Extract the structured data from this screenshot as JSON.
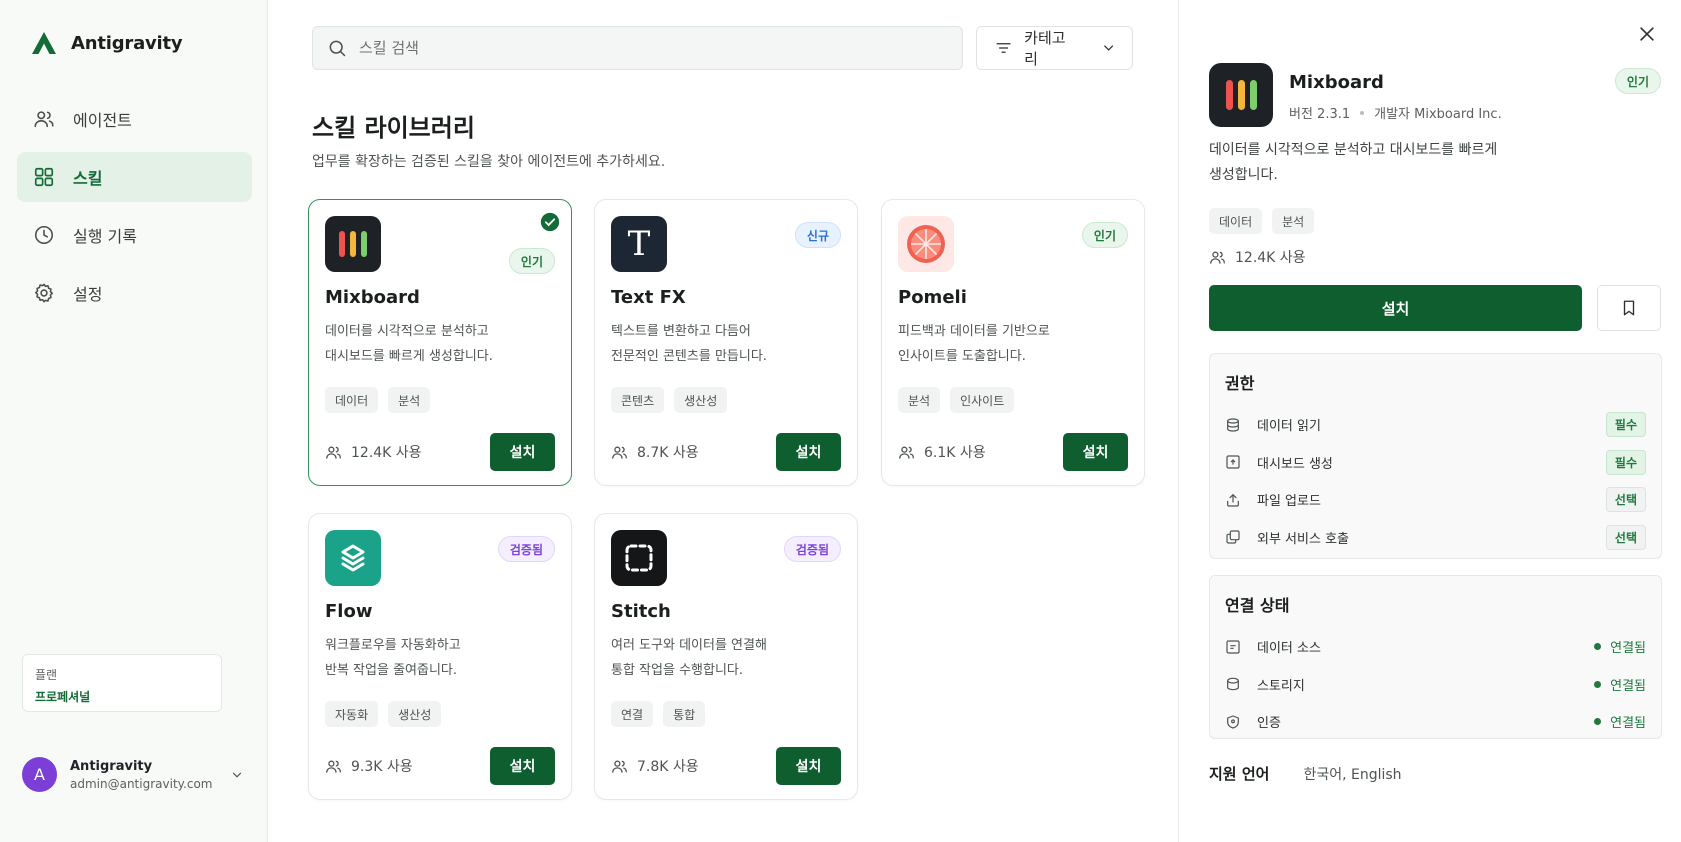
{
  "app": {
    "name": "Antigravity",
    "accent": "#0f5e30"
  },
  "sidebar": {
    "items": [
      {
        "label": "에이전트",
        "icon": "users-icon"
      },
      {
        "label": "스킬",
        "icon": "grid-icon",
        "active": true
      },
      {
        "label": "실행 기록",
        "icon": "clock-icon"
      },
      {
        "label": "설정",
        "icon": "gear-icon"
      }
    ],
    "plan": {
      "label": "플랜",
      "value": "프로페셔널"
    },
    "user": {
      "initial": "A",
      "name": "Antigravity",
      "email": "admin@antigravity.com"
    }
  },
  "main": {
    "search": {
      "placeholder": "스킬 검색"
    },
    "category_label": "카테고리",
    "title": "스킬 라이브러리",
    "subtitle": "업무를 확장하는 검증된 스킬을 찾아 에이전트에 추가하세요.",
    "install_label": "설치",
    "cards": [
      {
        "name": "Mixboard",
        "badge": "인기",
        "badge_type": "pop",
        "desc": [
          "데이터를 시각적으로 분석하고",
          "대시보드를 빠르게 생성합니다."
        ],
        "tags": [
          "데이터",
          "분석"
        ],
        "usage": "12.4K 사용",
        "selected": true
      },
      {
        "name": "Text FX",
        "badge": "신규",
        "badge_type": "new",
        "desc": [
          "텍스트를 변환하고 다듬어",
          "전문적인 콘텐츠를 만듭니다."
        ],
        "tags": [
          "콘텐츠",
          "생산성"
        ],
        "usage": "8.7K 사용"
      },
      {
        "name": "Pomeli",
        "badge": "인기",
        "badge_type": "pop",
        "desc": [
          "피드백과 데이터를 기반으로",
          "인사이트를 도출합니다."
        ],
        "tags": [
          "분석",
          "인사이트"
        ],
        "usage": "6.1K 사용"
      },
      {
        "name": "Flow",
        "badge": "검증됨",
        "badge_type": "ver",
        "desc": [
          "워크플로우를 자동화하고",
          "반복 작업을 줄여줍니다."
        ],
        "tags": [
          "자동화",
          "생산성"
        ],
        "usage": "9.3K 사용"
      },
      {
        "name": "Stitch",
        "badge": "검증됨",
        "badge_type": "ver",
        "desc": [
          "여러 도구와 데이터를 연결해",
          "통합 작업을 수행합니다."
        ],
        "tags": [
          "연결",
          "통합"
        ],
        "usage": "7.8K 사용"
      }
    ]
  },
  "detail": {
    "name": "Mixboard",
    "version": "버전 2.3.1",
    "developer": "개발자 Mixboard Inc.",
    "badge": "인기",
    "desc": [
      "데이터를 시각적으로 분석하고 대시보드를 빠르게",
      "생성합니다."
    ],
    "tags": [
      "데이터",
      "분석"
    ],
    "usage": "12.4K 사용",
    "install_label": "설치",
    "permissions": {
      "title": "권한",
      "items": [
        {
          "label": "데이터 읽기",
          "level": "필수",
          "type": "req",
          "icon": "database-icon"
        },
        {
          "label": "대시보드 생성",
          "level": "필수",
          "type": "req",
          "icon": "dashboard-icon"
        },
        {
          "label": "파일 업로드",
          "level": "선택",
          "type": "opt",
          "icon": "upload-icon"
        },
        {
          "label": "외부 서비스 호출",
          "level": "선택",
          "type": "opt",
          "icon": "external-service-icon"
        }
      ]
    },
    "connections": {
      "title": "연결 상태",
      "items": [
        {
          "label": "데이터 소스",
          "status": "연결됨",
          "icon": "data-source-icon"
        },
        {
          "label": "스토리지",
          "status": "연결됨",
          "icon": "storage-icon"
        },
        {
          "label": "인증",
          "status": "연결됨",
          "icon": "shield-icon"
        }
      ]
    },
    "languages": {
      "label": "지원 언어",
      "value": "한국어,  English"
    }
  }
}
